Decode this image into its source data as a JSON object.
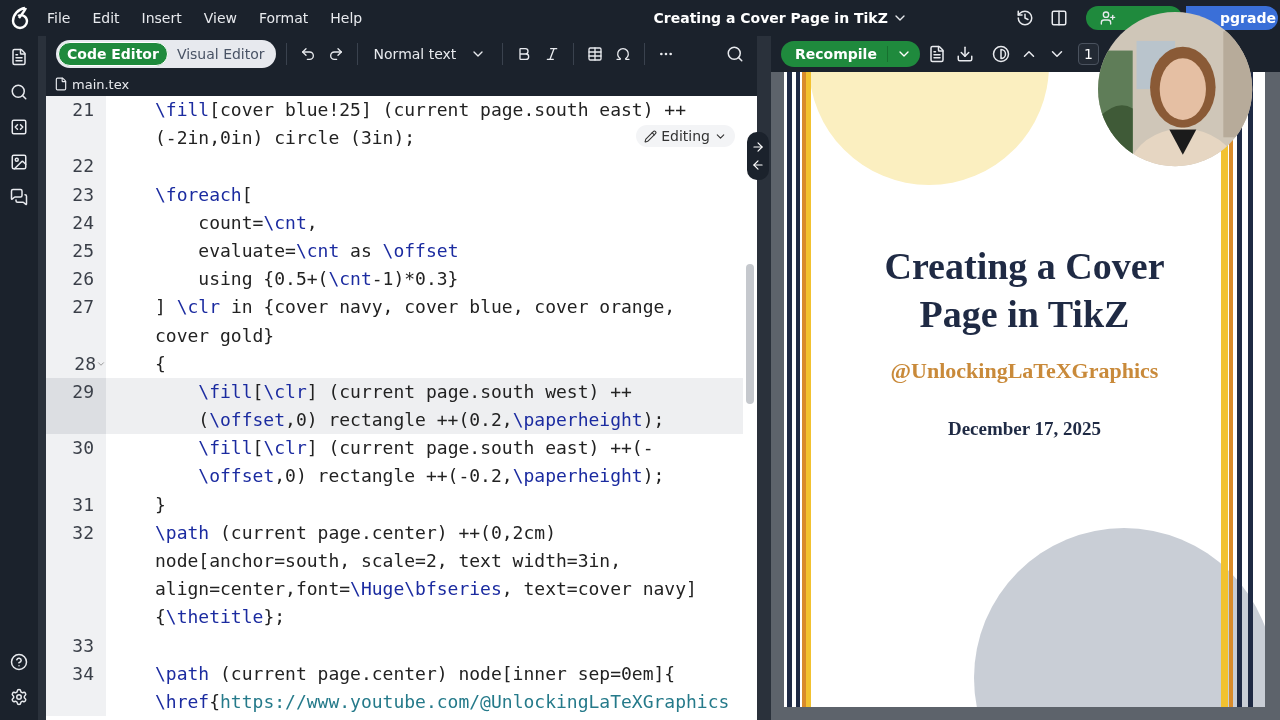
{
  "menu": [
    "File",
    "Edit",
    "Insert",
    "View",
    "Format",
    "Help"
  ],
  "title": "Creating a Cover Page in TikZ",
  "upgrade": "pgrade",
  "editor_modes": [
    {
      "label": "Code Editor",
      "selected": true
    },
    {
      "label": "Visual Editor",
      "selected": false
    }
  ],
  "text_style": "Normal text",
  "file_tab": "main.tex",
  "editing_badge": "Editing",
  "code": [
    {
      "number": "21",
      "active": false,
      "foldable": false,
      "lines": [
        "\\fill[cover blue!25] (current page.south east) ++",
        "(-2in,0in) circle (3in);"
      ]
    },
    {
      "number": "22",
      "active": false,
      "foldable": false
    },
    {
      "number": "23",
      "active": false,
      "foldable": false,
      "lines": [
        "\\foreach["
      ]
    },
    {
      "number": "24",
      "active": false,
      "foldable": false,
      "lines": [
        "    count=\\cnt,"
      ]
    },
    {
      "number": "25",
      "active": false,
      "foldable": false,
      "lines": [
        "    evaluate=\\cnt as \\offset"
      ]
    },
    {
      "number": "26",
      "active": false,
      "foldable": false,
      "lines": [
        "    using {0.5+(\\cnt-1)*0.3}"
      ]
    },
    {
      "number": "27",
      "active": false,
      "foldable": false,
      "lines": [
        "] \\clr in {cover navy, cover blue, cover orange,",
        "cover gold}"
      ]
    },
    {
      "number": "28",
      "active": false,
      "foldable": true,
      "lines": [
        "{"
      ]
    },
    {
      "number": "29",
      "active": true,
      "foldable": false,
      "lines": [
        "    \\fill[\\clr] (current page.south west) ++",
        "    (\\offset,0) rectangle ++(0.2,\\paperheight);"
      ]
    },
    {
      "number": "30",
      "active": false,
      "foldable": false,
      "lines": [
        "    \\fill[\\clr] (current page.south east) ++(-",
        "    \\offset,0) rectangle ++(-0.2,\\paperheight);"
      ]
    },
    {
      "number": "31",
      "active": false,
      "foldable": false,
      "lines": [
        "}"
      ]
    },
    {
      "number": "32",
      "active": false,
      "foldable": false,
      "lines": [
        "\\path (current page.center) ++(0,2cm)",
        "node[anchor=south, scale=2, text width=3in,",
        "align=center,font=\\Huge\\bfseries, text=cover navy]",
        "{\\thetitle};"
      ]
    },
    {
      "number": "33",
      "active": false,
      "foldable": false
    },
    {
      "number": "34",
      "active": false,
      "foldable": false,
      "lines": [
        "\\path (current page.center) node[inner sep=0em]{",
        "\\href{https://www.youtube.com/@UnlockingLaTeXGraphics"
      ]
    }
  ],
  "recompile": "Recompile",
  "page_number": "1",
  "pdf_page": {
    "title": "Creating a Cover Page in TikZ",
    "handle": "@UnlockingLaTeXGraphics",
    "date": "December 17, 2025"
  }
}
